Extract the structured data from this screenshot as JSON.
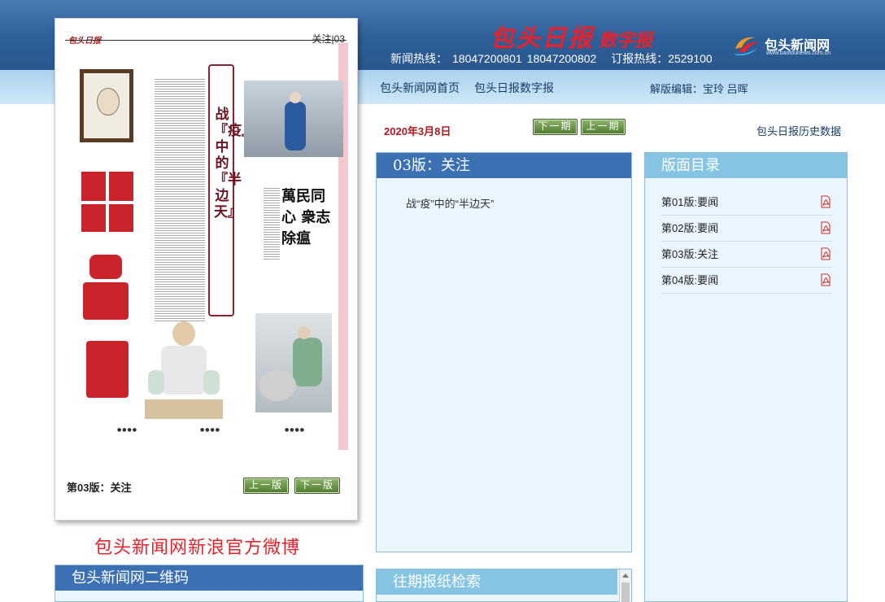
{
  "header": {
    "masthead": "包头日报",
    "masthead_suffix": "数字报",
    "news_hotline_label": "新闻热线：",
    "news_hotline_1": "18047200801",
    "news_hotline_2": "18047200802",
    "subscribe_label": "订报热线：",
    "subscribe_number": "2529100",
    "logo_text": "包头新闻网",
    "logo_url": "www.baotounews.com.cn"
  },
  "nav": {
    "home": "包头新闻网首页",
    "digital": "包头日报数字报",
    "editor": "解版编辑：宝玲 吕晖"
  },
  "paper": {
    "page_label": "关注|03",
    "headline_chars": [
      "战",
      "『疫』",
      "中的",
      "『半边天』"
    ],
    "calligraphy": "萬民同心 衆志除瘟",
    "footer_label": "第03版：关注",
    "prev_page": "上一版",
    "next_page": "下一版"
  },
  "issue": {
    "date": "2020年3月8日",
    "next_issue": "下一期",
    "prev_issue": "上一期",
    "history_link": "包头日报历史数据"
  },
  "section_panel": {
    "title": "03版：关注",
    "articles": [
      "战“疫”中的“半边天”"
    ]
  },
  "search_panel": {
    "title": "往期报纸检索"
  },
  "toc_panel": {
    "title": "版面目录",
    "items": [
      "第01版:要闻",
      "第02版:要闻",
      "第03版:关注",
      "第04版:要闻"
    ]
  },
  "weibo": "包头新闻网新浪官方微博",
  "qr_panel": {
    "title": "包头新闻网二维码"
  },
  "colors": {
    "header_blue": "#2e5f99",
    "panel_blue": "#3b70b2",
    "panel_light": "#86c4e3",
    "accent_red": "#e8212a"
  }
}
